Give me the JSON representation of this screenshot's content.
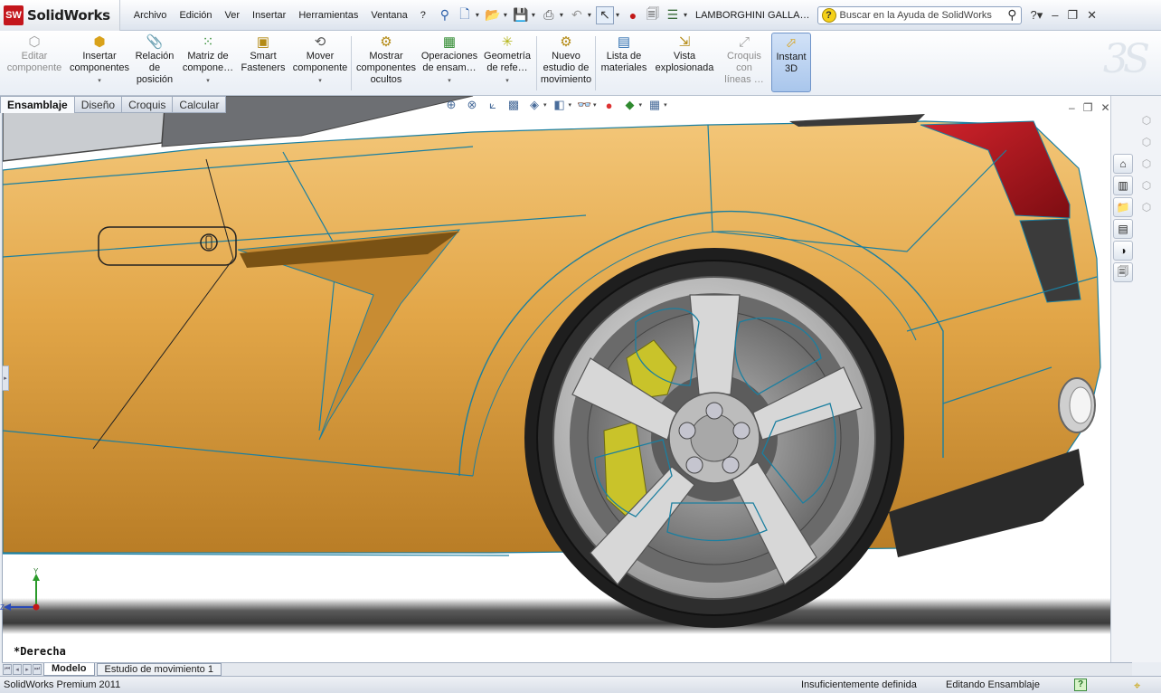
{
  "app": {
    "brand": "SolidWorks",
    "logo_badge": "SW",
    "document_name": "LAMBORGHINI GALLA…"
  },
  "menu": [
    "Archivo",
    "Edición",
    "Ver",
    "Insertar",
    "Herramientas",
    "Ventana",
    "?"
  ],
  "search": {
    "placeholder": "Buscar en la Ayuda de SolidWorks"
  },
  "command_manager": {
    "editar_componente": "Editar\ncomponente",
    "insertar_componentes": "Insertar\ncomponentes",
    "relacion_posicion": "Relación\nde\nposición",
    "matriz_componentes": "Matriz de\ncompone…",
    "smart_fasteners": "Smart\nFasteners",
    "mover_componente": "Mover\ncomponente",
    "mostrar_ocultos": "Mostrar\ncomponentes\nocultos",
    "operaciones_ensamblaje": "Operaciones\nde ensam…",
    "geometria_referencia": "Geometría\nde refe…",
    "nuevo_estudio": "Nuevo\nestudio de\nmovimiento",
    "lista_materiales": "Lista de\nmateriales",
    "vista_explosionada": "Vista\nexplosionada",
    "croquis_lineas": "Croquis\ncon\nlíneas …",
    "instant3d": "Instant\n3D"
  },
  "tabs": [
    "Ensamblaje",
    "Diseño",
    "Croquis",
    "Calcular"
  ],
  "viewport": {
    "view_name": "*Derecha"
  },
  "model_tabs": [
    "Modelo",
    "Estudio de movimiento 1"
  ],
  "status": {
    "product": "SolidWorks Premium 2011",
    "definition": "Insuficientemente definida",
    "mode": "Editando Ensamblaje",
    "help": "?"
  },
  "colors": {
    "body_paint": "#e2a648",
    "edge_lines": "#1b7fa0",
    "caliper": "#c9c32a",
    "taillight": "#b3141c",
    "accent": "#2a5ea8"
  }
}
